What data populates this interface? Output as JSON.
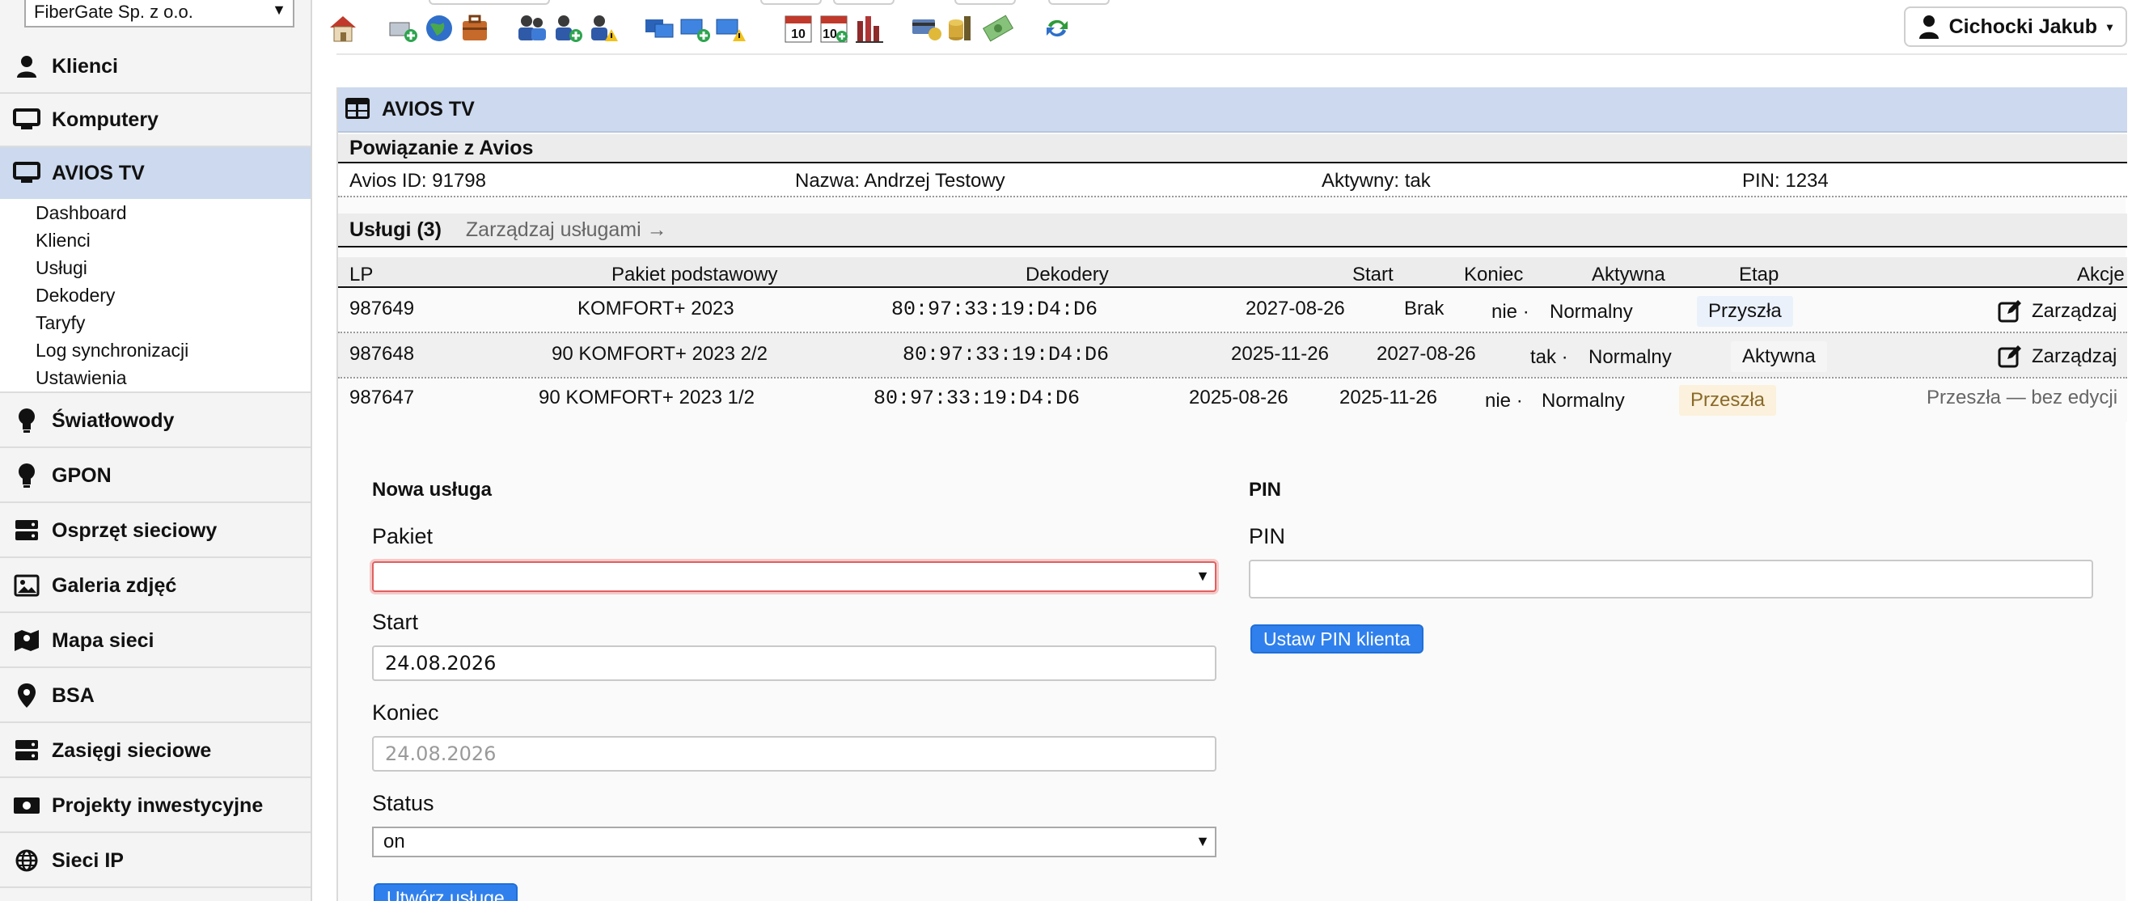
{
  "company": "FiberGate Sp. z o.o.",
  "user": "Cichocki Jakub",
  "nav": {
    "klienci": "Klienci",
    "komputery": "Komputery",
    "avios": "AVIOS TV",
    "swiatlowody": "Światłowody",
    "gpon": "GPON",
    "osprzet": "Osprzęt sieciowy",
    "galeria": "Galeria zdjęć",
    "mapa": "Mapa sieci",
    "bsa": "BSA",
    "zasiegi": "Zasięgi sieciowe",
    "projekty": "Projekty inwestycyjne",
    "sieci_ip": "Sieci IP"
  },
  "submenu": [
    "Dashboard",
    "Klienci",
    "Usługi",
    "Dekodery",
    "Taryfy",
    "Log synchronizacji",
    "Ustawienia"
  ],
  "panel": {
    "title": "AVIOS TV",
    "link_section": "Powiązanie z Avios",
    "avios_id": "Avios ID: 91798",
    "name": "Nazwa: Andrzej Testowy",
    "active": "Aktywny: tak",
    "pin": "PIN: 1234",
    "services_title": "Usługi (3)",
    "manage_services": "Zarządzaj usługami →"
  },
  "table": {
    "headers": {
      "lp": "LP",
      "pakiet": "Pakiet podstawowy",
      "dekodery": "Dekodery",
      "start": "Start",
      "koniec": "Koniec",
      "aktywna": "Aktywna",
      "etap": "Etap",
      "akcje": "Akcje"
    },
    "rows": [
      {
        "lp": "987649",
        "pakiet": "KOMFORT+ 2023",
        "dekoder": "80:97:33:19:D4:D6",
        "start": "2027-08-26",
        "koniec": "Brak",
        "aktywna": "nie ·",
        "status": "Normalny",
        "etap": "Przyszła",
        "akcje": "Zarządzaj"
      },
      {
        "lp": "987648",
        "pakiet": "90 KOMFORT+ 2023 2/2",
        "dekoder": "80:97:33:19:D4:D6",
        "start": "2025-11-26",
        "koniec": "2027-08-26",
        "aktywna": "tak ·",
        "status": "Normalny",
        "etap": "Aktywna",
        "akcje": "Zarządzaj"
      },
      {
        "lp": "987647",
        "pakiet": "90 KOMFORT+ 2023 1/2",
        "dekoder": "80:97:33:19:D4:D6",
        "start": "2025-08-26",
        "koniec": "2025-11-26",
        "aktywna": "nie ·",
        "status": "Normalny",
        "etap": "Przeszła",
        "akcje": "Przeszła — bez edycji"
      }
    ]
  },
  "new_service": {
    "title": "Nowa usługa",
    "pakiet_label": "Pakiet",
    "pakiet_value": "",
    "start_label": "Start",
    "start_value": "24.08.2026",
    "koniec_label": "Koniec",
    "koniec_value": "24.08.2026",
    "status_label": "Status",
    "status_value": "on",
    "submit": "Utwórz usługę"
  },
  "pin_form": {
    "title": "PIN",
    "label": "PIN",
    "value": "",
    "submit": "Ustaw PIN klienta"
  },
  "colors": {
    "active_nav": "#ccd9ee",
    "primary": "#2f80ed",
    "badge_future": "#eaf1fb",
    "badge_active": "#f0f0f0",
    "badge_past": "#fbf1dc"
  }
}
